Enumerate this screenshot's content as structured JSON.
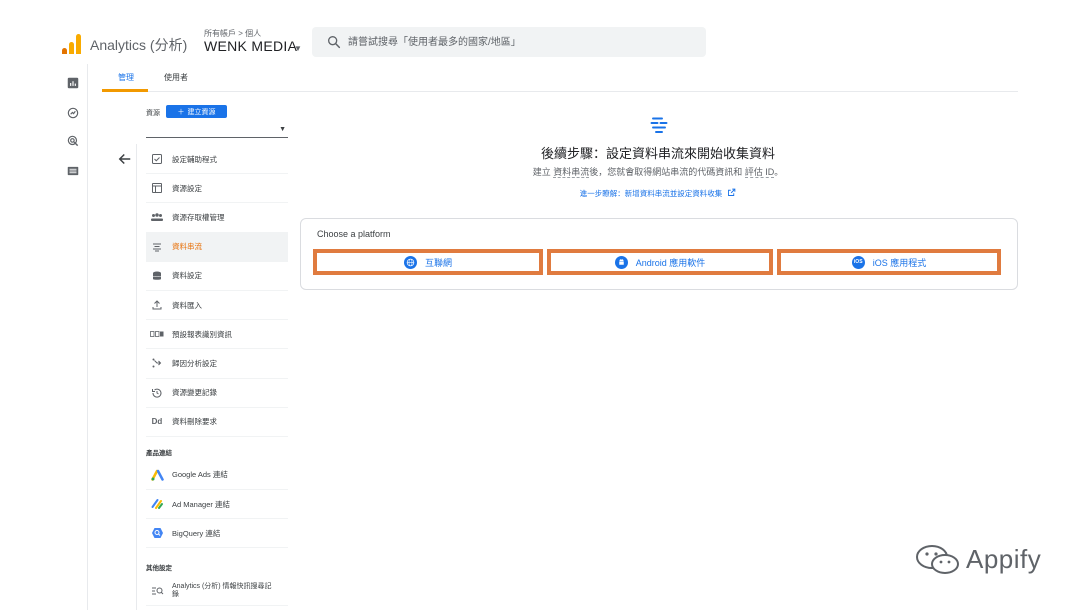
{
  "header": {
    "app_name": "Analytics (分析)",
    "account_crumb": "所有帳戶 > 個人",
    "account_name": "WENK MEDIA",
    "search_placeholder": "請嘗試搜尋「使用者最多的國家/地區」"
  },
  "tabs": [
    {
      "label": "管理",
      "active": true
    },
    {
      "label": "使用者",
      "active": false
    }
  ],
  "property": {
    "label": "資源",
    "create_label": "建立資源"
  },
  "menu": [
    {
      "label": "設定輔助程式",
      "icon": "checkbox-icon",
      "active": false
    },
    {
      "label": "資源設定",
      "icon": "property-settings-icon",
      "active": false
    },
    {
      "label": "資源存取權管理",
      "icon": "people-icon",
      "active": false
    },
    {
      "label": "資料串流",
      "icon": "data-streams-icon",
      "active": true
    },
    {
      "label": "資料設定",
      "icon": "database-icon",
      "active": false
    },
    {
      "label": "資料匯入",
      "icon": "upload-icon",
      "active": false
    },
    {
      "label": "預設報表識別資訊",
      "icon": "reporting-identity-icon",
      "active": false
    },
    {
      "label": "歸因分析設定",
      "icon": "attribution-icon",
      "active": false
    },
    {
      "label": "資源變更記錄",
      "icon": "history-icon",
      "active": false
    },
    {
      "label": "資料刪除要求",
      "icon": "data-deletion-icon",
      "active": false
    }
  ],
  "product_links": {
    "header": "產品連結",
    "items": [
      {
        "label": "Google Ads 連結",
        "icon": "google-ads-icon"
      },
      {
        "label": "Ad Manager 連結",
        "icon": "ad-manager-icon"
      },
      {
        "label": "BigQuery 連結",
        "icon": "bigquery-icon"
      }
    ]
  },
  "other_settings": {
    "header": "其他設定",
    "items": [
      {
        "label": "Analytics (分析) 情報快訊搜尋記錄",
        "icon": "search-history-icon"
      }
    ]
  },
  "main": {
    "title": "後續步驟：設定資料串流來開始收集資料",
    "desc_prefix": "建立 ",
    "desc_term1": "資料串流",
    "desc_middle": "後，您就會取得網站串流的代碼資訊和 ",
    "desc_term2": "評估 ID",
    "desc_suffix": "。",
    "link": "進一步瞭解：新增資料串流並設定資料收集"
  },
  "platform": {
    "label": "Choose a platform",
    "buttons": [
      {
        "label": "互聯網",
        "icon": "web-icon"
      },
      {
        "label": "Android 應用軟件",
        "icon": "android-icon"
      },
      {
        "label": "iOS 應用程式",
        "icon": "ios-icon"
      }
    ]
  },
  "watermark": {
    "text": "Appify"
  },
  "colors": {
    "accent_blue": "#1a73e8",
    "active_orange": "#e8710a",
    "highlight_border": "#e07b3f",
    "tab_underline": "#f29900"
  }
}
